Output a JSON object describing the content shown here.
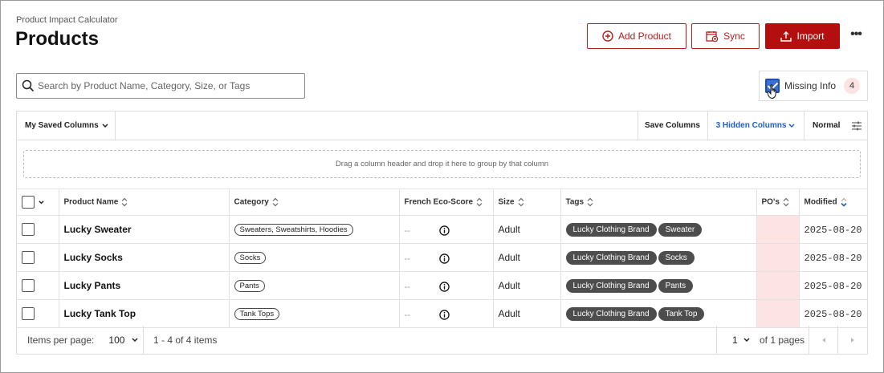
{
  "header": {
    "app_name": "Product Impact Calculator",
    "title": "Products",
    "add_product_label": "Add Product",
    "sync_label": "Sync",
    "import_label": "Import",
    "more_label": "•••"
  },
  "search": {
    "placeholder": "Search by Product Name, Category, Size, or Tags",
    "value": ""
  },
  "filter": {
    "label": "Missing Info",
    "count": "4",
    "checked": true
  },
  "toolbar": {
    "saved_columns_label": "My Saved Columns",
    "save_columns_label": "Save Columns",
    "hidden_columns_label": "3 Hidden Columns",
    "density_label": "Normal"
  },
  "group_hint": "Drag a column header and drop it here to group by that column",
  "columns": {
    "product_name": "Product Name",
    "category": "Category",
    "eco_score": "French Eco-Score",
    "size": "Size",
    "tags": "Tags",
    "pos": "PO's",
    "modified": "Modified"
  },
  "rows": [
    {
      "name": "Lucky Sweater",
      "category": "Sweaters, Sweatshirts, Hoodies",
      "eco": "--",
      "size": "Adult",
      "tags": [
        "Lucky Clothing Brand",
        "Sweater"
      ],
      "modified": "2025-08-20"
    },
    {
      "name": "Lucky Socks",
      "category": "Socks",
      "eco": "--",
      "size": "Adult",
      "tags": [
        "Lucky Clothing Brand",
        "Socks"
      ],
      "modified": "2025-08-20"
    },
    {
      "name": "Lucky Pants",
      "category": "Pants",
      "eco": "--",
      "size": "Adult",
      "tags": [
        "Lucky Clothing Brand",
        "Pants"
      ],
      "modified": "2025-08-20"
    },
    {
      "name": "Lucky Tank Top",
      "category": "Tank Tops",
      "eco": "--",
      "size": "Adult",
      "tags": [
        "Lucky Clothing Brand",
        "Tank Top"
      ],
      "modified": "2025-08-20"
    }
  ],
  "footer": {
    "items_per_page_label": "Items per page:",
    "items_per_page_value": "100",
    "range_label": "1 - 4 of 4 items",
    "page_value": "1",
    "pages_label": "of 1 pages"
  },
  "colors": {
    "accent": "#b50e0e",
    "link": "#1c5ec4",
    "missing_highlight": "#fde3e3",
    "tag_bg": "#4d4d4d"
  }
}
